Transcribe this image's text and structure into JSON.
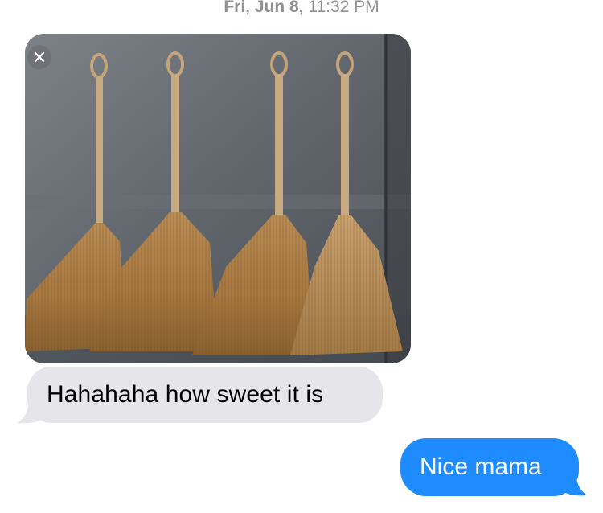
{
  "header": {
    "day_label": "Fri, Jun 8,",
    "time_label": "11:32 PM"
  },
  "attachment": {
    "close_icon": "close-icon",
    "subject": "four straw brooms hanging on a concrete wall"
  },
  "messages": [
    {
      "direction": "incoming",
      "text": "Hahahaha how sweet it is"
    },
    {
      "direction": "outgoing",
      "text": "Nice mama"
    }
  ],
  "colors": {
    "incoming_bubble": "#e5e5ea",
    "outgoing_bubble": "#1e8bff",
    "timestamp": "#8e8e93"
  }
}
